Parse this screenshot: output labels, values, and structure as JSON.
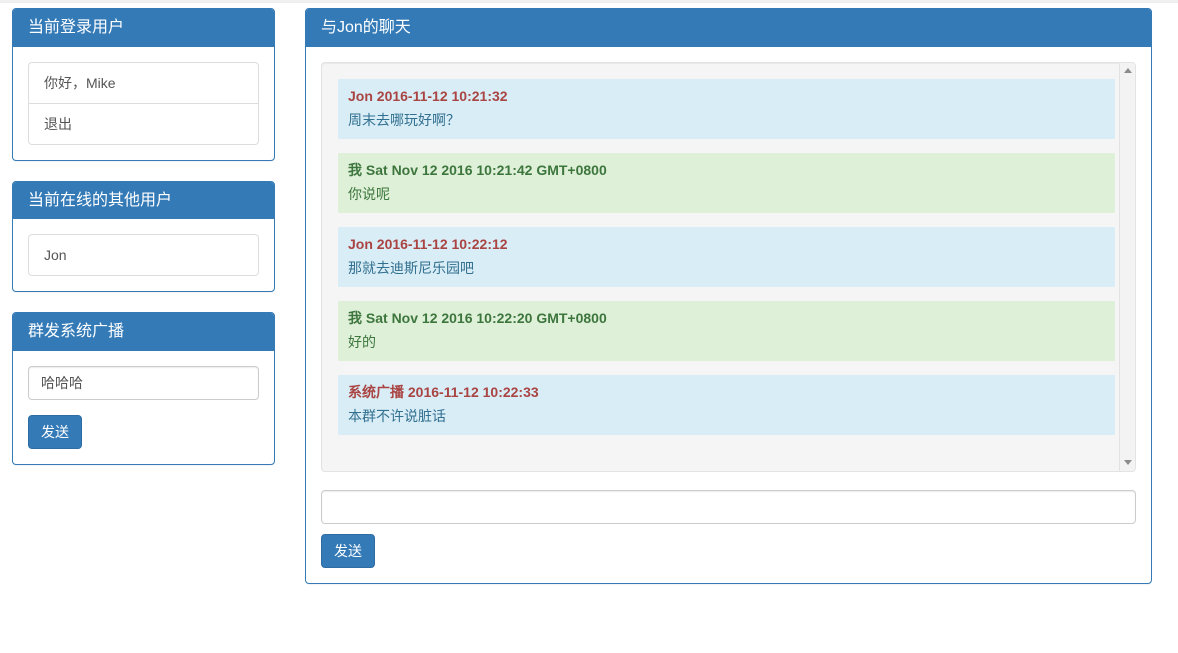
{
  "left_column": {
    "current_user_panel": {
      "title": "当前登录用户",
      "items": [
        {
          "label": "你好，Mike"
        },
        {
          "label": "退出"
        }
      ]
    },
    "online_users_panel": {
      "title": "当前在线的其他用户",
      "items": [
        {
          "label": "Jon"
        }
      ]
    },
    "broadcast_panel": {
      "title": "群发系统广播",
      "input_value": "哈哈哈",
      "input_placeholder": "",
      "send_label": "发送"
    }
  },
  "chat_panel": {
    "title": "与Jon的聊天",
    "messages": [
      {
        "kind": "other",
        "head": "Jon 2016-11-12 10:21:32",
        "body": "周末去哪玩好啊？"
      },
      {
        "kind": "self",
        "head": "我 Sat Nov 12 2016 10:21:42 GMT+0800",
        "body": "你说呢"
      },
      {
        "kind": "other",
        "head": "Jon 2016-11-12 10:22:12",
        "body": "那就去迪斯尼乐园吧"
      },
      {
        "kind": "self",
        "head": "我 Sat Nov 12 2016 10:22:20 GMT+0800",
        "body": "好的"
      },
      {
        "kind": "other",
        "head": "系统广播 2016-11-12 10:22:33",
        "body": "本群不许说脏话"
      }
    ],
    "input_value": "",
    "input_placeholder": "",
    "send_label": "发送",
    "scrollbar": {
      "up_icon": "triangle-up-icon",
      "down_icon": "triangle-down-icon"
    }
  },
  "colors": {
    "panel_header": "#337ab7",
    "button_primary": "#337ab7",
    "msg_other_bg": "#d9edf7",
    "msg_self_bg": "#dff0d8",
    "msg_other_head": "#a94442",
    "msg_self_head": "#3c763d",
    "msg_other_body": "#31708f",
    "msg_self_body": "#3c763d"
  }
}
